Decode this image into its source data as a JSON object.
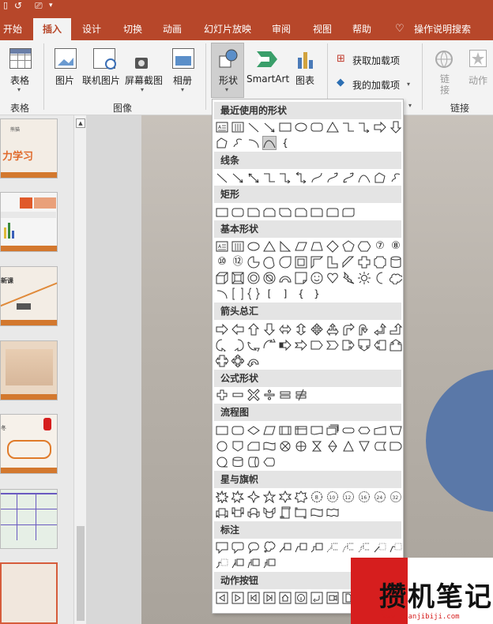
{
  "tabs": [
    {
      "label": "开始"
    },
    {
      "label": "插入"
    },
    {
      "label": "设计"
    },
    {
      "label": "切换"
    },
    {
      "label": "动画"
    },
    {
      "label": "幻灯片放映"
    },
    {
      "label": "审阅"
    },
    {
      "label": "视图"
    },
    {
      "label": "帮助"
    },
    {
      "label": "操作说明搜索"
    }
  ],
  "ribbon": {
    "table_label": "表格",
    "image_label": "图片",
    "online_image_label": "联机图片",
    "screenshot_label": "屏幕截图",
    "album_label": "相册",
    "shapes_label": "形状",
    "smartart_label": "SmartArt",
    "chart_label": "图表",
    "get_addins_label": "获取加载项",
    "my_addins_label": "我的加载项",
    "link_label": "链\n接",
    "action_label": "动作",
    "groups": {
      "table": "表格",
      "images": "图像",
      "links": "链接"
    }
  },
  "thumbs": {
    "t1_title": "力学习",
    "t1_small": "熊猫",
    "t2_foot": "",
    "t3_text": "新课",
    "t5_text": "冬"
  },
  "dropdown": {
    "sections": [
      "最近使用的形状",
      "线条",
      "矩形",
      "基本形状",
      "箭头总汇",
      "公式形状",
      "流程图",
      "星与旗帜",
      "标注",
      "动作按钮"
    ],
    "basic_number_shapes": [
      "⑦",
      "⑧",
      "⑩",
      "⑫"
    ],
    "braces": [
      "{",
      "}",
      "[",
      "]",
      "{",
      "}"
    ]
  },
  "watermark": {
    "title": "攒机笔记",
    "url": "www.cuanjibiji.com"
  },
  "colors": {
    "accent": "#b7472a",
    "slide_circle": "#5a78a8"
  }
}
